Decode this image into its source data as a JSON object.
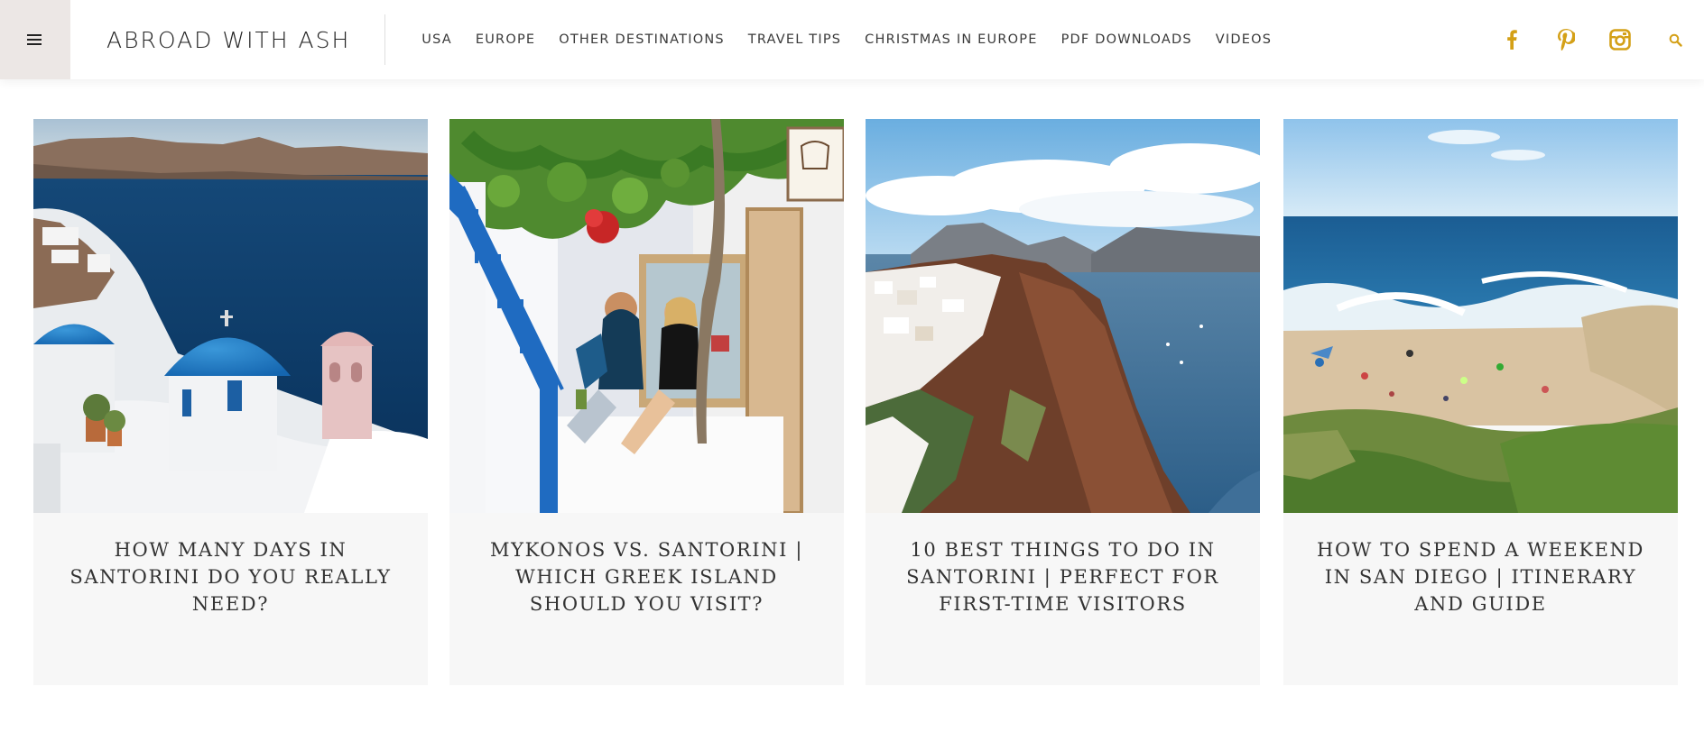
{
  "site": {
    "logo": "ABROAD WITH ASH",
    "brand_color": "#d4a017"
  },
  "nav": {
    "items": [
      {
        "label": "USA"
      },
      {
        "label": "EUROPE"
      },
      {
        "label": "OTHER DESTINATIONS"
      },
      {
        "label": "TRAVEL TIPS"
      },
      {
        "label": "CHRISTMAS IN EUROPE"
      },
      {
        "label": "PDF DOWNLOADS"
      },
      {
        "label": "VIDEOS"
      }
    ]
  },
  "social": {
    "icons": [
      "facebook-icon",
      "pinterest-icon",
      "instagram-icon",
      "search-icon"
    ]
  },
  "posts": [
    {
      "title": "HOW MANY DAYS IN SANTORINI DO YOU REALLY NEED?",
      "image": "santorini-blue-domes"
    },
    {
      "title": "MYKONOS VS. SANTORINI | WHICH GREEK ISLAND SHOULD YOU VISIT?",
      "image": "mykonos-couple-cafe"
    },
    {
      "title": "10 BEST THINGS TO DO IN SANTORINI | PERFECT FOR FIRST-TIME VISITORS",
      "image": "santorini-caldera-cliffs"
    },
    {
      "title": "HOW TO SPEND A WEEKEND IN SAN DIEGO | ITINERARY AND GUIDE",
      "image": "san-diego-beach"
    }
  ]
}
